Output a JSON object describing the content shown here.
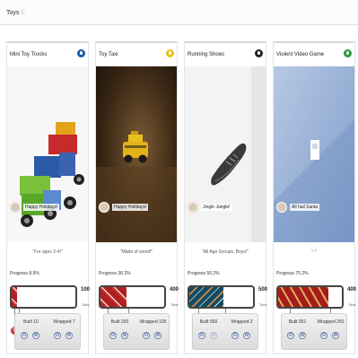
{
  "header": {
    "title": "Toys",
    "caret": "☆"
  },
  "colors": {
    "white_heart": "#ffffff"
  },
  "cards": [
    {
      "name": "Mini Toy Trucks",
      "dot_color": "#1a5aa8",
      "image": "toy-trucks",
      "owner": "Happy Holidays!",
      "quote": "For ages 2-4!",
      "progress_label": "Progress 8.5%",
      "progress": 0.085,
      "fill_style": "red",
      "goal": "100",
      "goal_sub": "Total",
      "built_label": "Built 10",
      "wrapped_label": "Wrapped 7",
      "built_minus": "⊖",
      "built_plus": "⊕",
      "wrapped_minus": "⊖",
      "wrapped_plus": "⊕"
    },
    {
      "name": "Toy Taxi",
      "dot_color": "#e8c21a",
      "image": "toy-taxi",
      "owner": "Happy Holidays!",
      "quote": "Made of wood!",
      "progress_label": "Progress 38.2%",
      "progress": 0.382,
      "fill_style": "red",
      "goal": "400",
      "goal_sub": "Total",
      "built_label": "Built 200",
      "wrapped_label": "Wrapped 105",
      "built_minus": "⊖",
      "built_plus": "⊕",
      "wrapped_minus": "⊖",
      "wrapped_plus": "⊕"
    },
    {
      "name": "Running Shoes",
      "dot_color": "#222222",
      "image": "running-shoe",
      "owner": "Jingle Jangle!",
      "quote": "All Age Groups, Boys!",
      "progress_label": "Progress 50.2%",
      "progress": 0.502,
      "fill_style": "teal",
      "goal": "500",
      "goal_sub": "Total",
      "built_label": "Built 500",
      "wrapped_label": "Wrapped 2",
      "built_minus": "⊖",
      "built_plus": "⊕",
      "wrapped_minus": "⊖",
      "wrapped_plus": "⊕"
    },
    {
      "name": "Violent Video Game",
      "dot_color": "#2a9a3a",
      "image": "video-game",
      "owner": "All hail Santa",
      "quote": "-",
      "progress_label": "Progress 75.2%",
      "progress": 0.752,
      "fill_style": "gold",
      "goal": "400",
      "goal_sub": "Total",
      "built_label": "Built 351",
      "wrapped_label": "Wrapped 250",
      "built_minus": "⊖",
      "built_plus": "⊕",
      "wrapped_minus": "⊖",
      "wrapped_plus": "⊕"
    }
  ]
}
